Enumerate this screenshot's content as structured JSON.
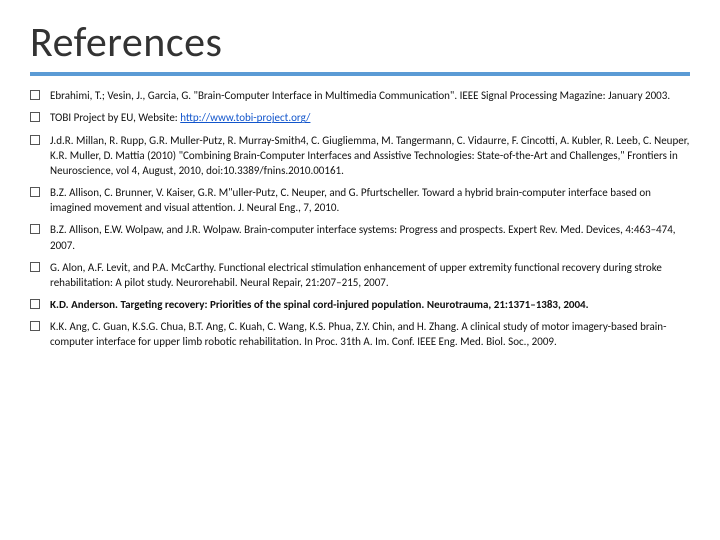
{
  "page": {
    "title": "References",
    "underline_color": "#5b9bd5"
  },
  "references": [
    {
      "id": "ref1",
      "text": "Ebrahimi, T.; Vesin, J., Garcia, G. \"Brain-Computer Interface in Multimedia Communication\". IEEE Signal Processing Magazine: January 2003.",
      "has_link": false
    },
    {
      "id": "ref2",
      "text_before": "TOBI Project by EU, Website: ",
      "link_text": "http://www.tobi-project.org/",
      "link_href": "http://www.tobi-project.org/",
      "text_after": "",
      "has_link": true
    },
    {
      "id": "ref3",
      "text": "J.d.R. Millan, R. Rupp, G.R. Muller-Putz, R. Murray-Smith4, C. Giugliemma, M. Tangermann, C. Vidaurre, F. Cincotti, A. Kubler, R. Leeb, C. Neuper, K.R. Muller, D. Mattia (2010) \"Combining Brain-Computer Interfaces and Assistive Technologies: State-of-the-Art and Challenges,\" Frontiers in Neuroscience, vol 4, August, 2010, doi:10.3389/fnins.2010.00161.",
      "has_link": false
    },
    {
      "id": "ref4",
      "text": "B.Z. Allison, C. Brunner, V. Kaiser, G.R. M\"uller-Putz, C. Neuper, and G. Pfurtscheller. Toward a hybrid brain-computer interface based on imagined movement and visual attention. J. Neural Eng., 7, 2010.",
      "has_link": false
    },
    {
      "id": "ref5",
      "text": "B.Z. Allison, E.W. Wolpaw, and J.R. Wolpaw. Brain-computer interface systems: Progress and prospects. Expert Rev. Med. Devices, 4:463–474, 2007.",
      "has_link": false
    },
    {
      "id": "ref6",
      "text": "G. Alon, A.F. Levit, and P.A. McCarthy. Functional electrical stimulation enhancement of upper extremity functional recovery during stroke rehabilitation: A pilot study. Neurorehabil. Neural Repair, 21:207–215, 2007.",
      "has_link": false
    },
    {
      "id": "ref7",
      "text": "K.D. Anderson. Targeting recovery: Priorities of the spinal cord-injured population. Neurotrauma, 21:1371–1383, 2004.",
      "has_link": false,
      "bold_end": true
    },
    {
      "id": "ref8",
      "text": "K.K. Ang, C. Guan, K.S.G. Chua, B.T. Ang, C. Kuah, C. Wang, K.S. Phua, Z.Y. Chin, and H. Zhang. A clinical study of motor imagery-based brain-computer interface for upper limb robotic rehabilitation. In Proc. 31th A. Im. Conf. IEEE Eng. Med. Biol. Soc., 2009.",
      "has_link": false
    }
  ]
}
